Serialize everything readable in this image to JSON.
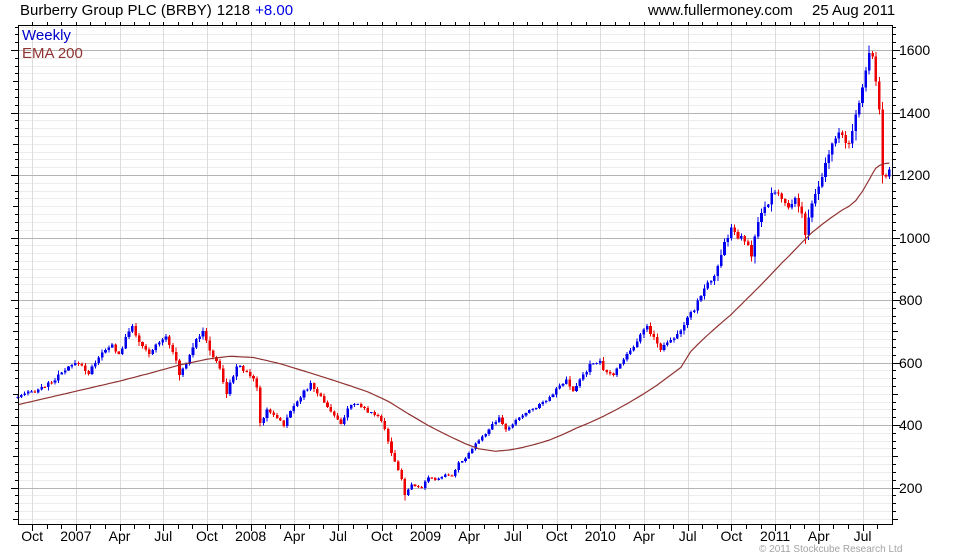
{
  "header": {
    "title_name": "Burberry Group PLC (BRBY)",
    "price": "1218",
    "change": "+8.00",
    "website": "www.fullermoney.com",
    "date": "25 Aug 2011"
  },
  "legend": {
    "weekly": "Weekly",
    "ema": "EMA 200"
  },
  "footer": {
    "copyright": "© 2011 Stockcube Research Ltd"
  },
  "colors": {
    "up_candle": "#0000ee",
    "down_candle": "#ee0000",
    "ema_line": "#8f3432",
    "grid_minor": "#ececec",
    "grid_major": "#b4b4b4",
    "grid_vertical": "#dcdcdc",
    "axis": "#000000",
    "accent_blue": "#0000cc",
    "copyright_gray": "#a3a3a3"
  },
  "chart_data": {
    "type": "candlestick",
    "timeframe": "weekly",
    "title": "Burberry Group PLC (BRBY)",
    "last_close": 1218,
    "last_change": 8.0,
    "n_weeks": 260,
    "ylim": [
      80,
      1680
    ],
    "y_ticks": [
      200,
      400,
      600,
      800,
      1000,
      1200,
      1400,
      1600
    ],
    "y_minor_step": 25,
    "y_axis_side": "right",
    "grid": true,
    "legend_entries": [
      "Weekly",
      "EMA 200"
    ],
    "x_ticks": [
      {
        "label": "Oct",
        "week": 4.2
      },
      {
        "label": "2007",
        "week": 17.19
      },
      {
        "label": "Apr",
        "week": 30.18
      },
      {
        "label": "Jul",
        "week": 43.17
      },
      {
        "label": "Oct",
        "week": 56.16
      },
      {
        "label": "2008",
        "week": 69.15
      },
      {
        "label": "Apr",
        "week": 82.14
      },
      {
        "label": "Jul",
        "week": 95.13
      },
      {
        "label": "Oct",
        "week": 108.12
      },
      {
        "label": "2009",
        "week": 121.11
      },
      {
        "label": "Apr",
        "week": 134.1
      },
      {
        "label": "Jul",
        "week": 147.09
      },
      {
        "label": "Oct",
        "week": 160.08
      },
      {
        "label": "2010",
        "week": 173.07
      },
      {
        "label": "Apr",
        "week": 186.06
      },
      {
        "label": "Jul",
        "week": 199.05
      },
      {
        "label": "Oct",
        "week": 212.04
      },
      {
        "label": "2011",
        "week": 225.03
      },
      {
        "label": "Apr",
        "week": 238.02
      },
      {
        "label": "Jul",
        "week": 251.01
      }
    ],
    "month_tick_start_week": 4.2,
    "month_tick_step_weeks": 4.33,
    "close_keyframes": [
      [
        0,
        490
      ],
      [
        4,
        505
      ],
      [
        9,
        530
      ],
      [
        13,
        565
      ],
      [
        16,
        590
      ],
      [
        18,
        600
      ],
      [
        21,
        565
      ],
      [
        24,
        620
      ],
      [
        28,
        655
      ],
      [
        30,
        625
      ],
      [
        33,
        700
      ],
      [
        34,
        722
      ],
      [
        36,
        660
      ],
      [
        39,
        625
      ],
      [
        42,
        670
      ],
      [
        44,
        685
      ],
      [
        46,
        640
      ],
      [
        48,
        560
      ],
      [
        50,
        600
      ],
      [
        53,
        680
      ],
      [
        55,
        695
      ],
      [
        57,
        640
      ],
      [
        60,
        580
      ],
      [
        62,
        500
      ],
      [
        65,
        590
      ],
      [
        68,
        570
      ],
      [
        70,
        545
      ],
      [
        71,
        520
      ],
      [
        72,
        405
      ],
      [
        74,
        450
      ],
      [
        77,
        425
      ],
      [
        79,
        400
      ],
      [
        82,
        465
      ],
      [
        85,
        505
      ],
      [
        87,
        530
      ],
      [
        90,
        490
      ],
      [
        93,
        445
      ],
      [
        96,
        400
      ],
      [
        98,
        455
      ],
      [
        101,
        465
      ],
      [
        104,
        445
      ],
      [
        107,
        430
      ],
      [
        109,
        390
      ],
      [
        111,
        310
      ],
      [
        114,
        230
      ],
      [
        115,
        175
      ],
      [
        117,
        210
      ],
      [
        120,
        200
      ],
      [
        122,
        235
      ],
      [
        124,
        225
      ],
      [
        127,
        240
      ],
      [
        129,
        235
      ],
      [
        131,
        280
      ],
      [
        133,
        295
      ],
      [
        136,
        340
      ],
      [
        138,
        360
      ],
      [
        141,
        400
      ],
      [
        143,
        420
      ],
      [
        145,
        385
      ],
      [
        147,
        400
      ],
      [
        149,
        425
      ],
      [
        152,
        445
      ],
      [
        155,
        465
      ],
      [
        158,
        490
      ],
      [
        161,
        525
      ],
      [
        163,
        540
      ],
      [
        165,
        505
      ],
      [
        167,
        545
      ],
      [
        170,
        590
      ],
      [
        173,
        610
      ],
      [
        174,
        570
      ],
      [
        177,
        560
      ],
      [
        179,
        600
      ],
      [
        182,
        640
      ],
      [
        185,
        690
      ],
      [
        187,
        715
      ],
      [
        189,
        680
      ],
      [
        191,
        640
      ],
      [
        193,
        670
      ],
      [
        196,
        690
      ],
      [
        198,
        720
      ],
      [
        201,
        770
      ],
      [
        203,
        820
      ],
      [
        205,
        850
      ],
      [
        208,
        900
      ],
      [
        210,
        980
      ],
      [
        212,
        1030
      ],
      [
        214,
        1000
      ],
      [
        216,
        990
      ],
      [
        218,
        945
      ],
      [
        220,
        1050
      ],
      [
        223,
        1110
      ],
      [
        225,
        1155
      ],
      [
        227,
        1120
      ],
      [
        229,
        1090
      ],
      [
        231,
        1130
      ],
      [
        233,
        1080
      ],
      [
        234,
        1010
      ],
      [
        236,
        1100
      ],
      [
        238,
        1160
      ],
      [
        240,
        1230
      ],
      [
        242,
        1300
      ],
      [
        244,
        1330
      ],
      [
        246,
        1300
      ],
      [
        248,
        1330
      ],
      [
        249,
        1380
      ],
      [
        251,
        1480
      ],
      [
        253,
        1590
      ],
      [
        254,
        1580
      ],
      [
        255,
        1500
      ],
      [
        256,
        1410
      ],
      [
        257,
        1200
      ],
      [
        258,
        1195
      ],
      [
        259,
        1218
      ]
    ],
    "ema_keyframes": [
      [
        0,
        465
      ],
      [
        12,
        495
      ],
      [
        20,
        515
      ],
      [
        30,
        540
      ],
      [
        40,
        568
      ],
      [
        48,
        592
      ],
      [
        57,
        612
      ],
      [
        63,
        620
      ],
      [
        70,
        616
      ],
      [
        78,
        596
      ],
      [
        84,
        576
      ],
      [
        90,
        556
      ],
      [
        98,
        528
      ],
      [
        104,
        506
      ],
      [
        110,
        476
      ],
      [
        116,
        436
      ],
      [
        122,
        398
      ],
      [
        128,
        365
      ],
      [
        133,
        340
      ],
      [
        137,
        324
      ],
      [
        142,
        316
      ],
      [
        146,
        320
      ],
      [
        150,
        328
      ],
      [
        155,
        342
      ],
      [
        158,
        352
      ],
      [
        162,
        370
      ],
      [
        166,
        390
      ],
      [
        170,
        408
      ],
      [
        174,
        428
      ],
      [
        178,
        450
      ],
      [
        182,
        474
      ],
      [
        186,
        500
      ],
      [
        190,
        528
      ],
      [
        194,
        560
      ],
      [
        197,
        584
      ],
      [
        200,
        636
      ],
      [
        203,
        668
      ],
      [
        206,
        698
      ],
      [
        209,
        726
      ],
      [
        212,
        754
      ],
      [
        215,
        786
      ],
      [
        218,
        818
      ],
      [
        221,
        850
      ],
      [
        224,
        884
      ],
      [
        227,
        918
      ],
      [
        230,
        950
      ],
      [
        233,
        984
      ],
      [
        236,
        1016
      ],
      [
        239,
        1042
      ],
      [
        242,
        1066
      ],
      [
        245,
        1088
      ],
      [
        247,
        1100
      ],
      [
        249,
        1118
      ],
      [
        251,
        1148
      ],
      [
        253,
        1185
      ],
      [
        254,
        1205
      ],
      [
        255,
        1222
      ],
      [
        256,
        1230
      ],
      [
        257,
        1235
      ],
      [
        258,
        1237
      ],
      [
        259,
        1238
      ]
    ],
    "extremes": {
      "peak_2011_high": 1615,
      "low_2008": 158
    }
  }
}
